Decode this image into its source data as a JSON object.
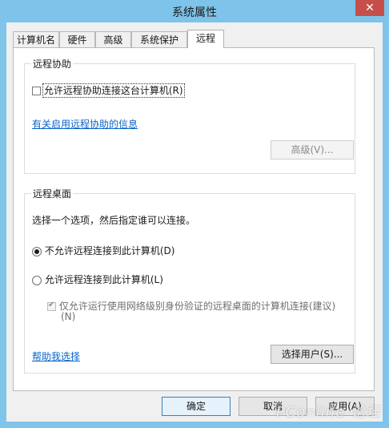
{
  "window": {
    "title": "系统属性",
    "close_glyph": "✕"
  },
  "tabs": [
    {
      "label": "计算机名"
    },
    {
      "label": "硬件"
    },
    {
      "label": "高级"
    },
    {
      "label": "系统保护"
    },
    {
      "label": "远程",
      "active": true
    }
  ],
  "remote_assistance": {
    "group_title": "远程协助",
    "allow_checkbox_label": "允许远程协助连接这台计算机(R)",
    "allow_checked": false,
    "info_link": "有关启用远程协助的信息",
    "advanced_button": "高级(V)..."
  },
  "remote_desktop": {
    "group_title": "远程桌面",
    "instruction": "选择一个选项，然后指定谁可以连接。",
    "option_deny": "不允许远程连接到此计算机(D)",
    "option_deny_selected": true,
    "option_allow": "允许远程连接到此计算机(L)",
    "option_allow_selected": false,
    "nla_label_line1": "仅允许运行使用网络级别身份验证的远程桌面的计算机连接(建议)",
    "nla_label_line2": "(N)",
    "nla_checked": true,
    "help_link": "帮助我选择",
    "select_users_button": "选择用户(S)..."
  },
  "footer": {
    "ok_button": "确定",
    "cancel_button": "取消",
    "apply_button": "应用(A)"
  },
  "watermark": {
    "text": "PConline 论坛"
  }
}
